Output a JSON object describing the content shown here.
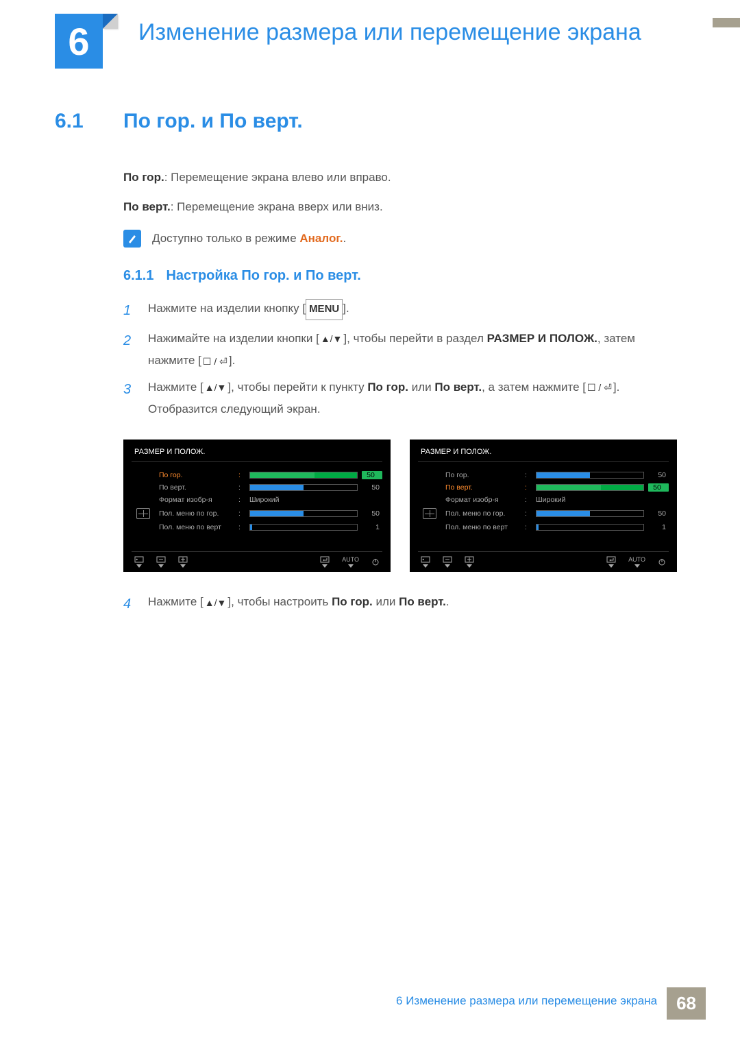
{
  "chapter": {
    "number": "6",
    "title": "Изменение размера или перемещение экрана"
  },
  "section": {
    "number": "6.1",
    "title": "По гор. и По верт."
  },
  "para1": {
    "label": "По гор.",
    "text": ": Перемещение экрана влево или вправо."
  },
  "para2": {
    "label": "По верт.",
    "text": ": Перемещение экрана вверх или вниз."
  },
  "note": {
    "pre": "Доступно только в режиме ",
    "mode": "Аналог.",
    "post": "."
  },
  "subsection": {
    "number": "6.1.1",
    "title": "Настройка По гор. и По верт."
  },
  "steps": {
    "s1": {
      "n": "1",
      "pre": "Нажмите на изделии кнопку [",
      "menu": "MENU",
      "post": "]."
    },
    "s2": {
      "n": "2",
      "pre": "Нажимайте на изделии кнопки [",
      "keys": "▲/▼",
      "mid": "], чтобы перейти в раздел ",
      "target": "РАЗМЕР И ПОЛОЖ.",
      "mid2": ", затем нажмите [",
      "keys2": "☐ / ⏎",
      "post": "]."
    },
    "s3": {
      "n": "3",
      "pre": "Нажмите [",
      "keys": "▲/▼",
      "mid": "], чтобы перейти к пункту ",
      "t1": "По гор.",
      "or": " или ",
      "t2": "По верт.",
      "mid2": ", а затем нажмите [",
      "keys2": "☐ / ⏎",
      "post": "]. Отобразится следующий экран."
    },
    "s4": {
      "n": "4",
      "pre": "Нажмите [",
      "keys": "▲/▼",
      "mid": "], чтобы настроить ",
      "t1": "По гор.",
      "or": " или ",
      "t2": "По верт.",
      "post": "."
    }
  },
  "osd": {
    "title": "РАЗМЕР И ПОЛОЖ.",
    "rows": {
      "r1": {
        "label": "По гор.",
        "value": "50",
        "fill": 60
      },
      "r2": {
        "label": "По верт.",
        "value": "50",
        "fill": 50
      },
      "r3": {
        "label": "Формат изобр-я",
        "text": "Широкий"
      },
      "r4": {
        "label": "Пол. меню по гор.",
        "value": "50",
        "fill": 50
      },
      "r5": {
        "label": "Пол. меню по верт",
        "value": "1",
        "fill": 2
      }
    },
    "controls": {
      "auto": "AUTO"
    }
  },
  "footer": {
    "text": "6 Изменение размера или перемещение экрана",
    "page": "68"
  }
}
